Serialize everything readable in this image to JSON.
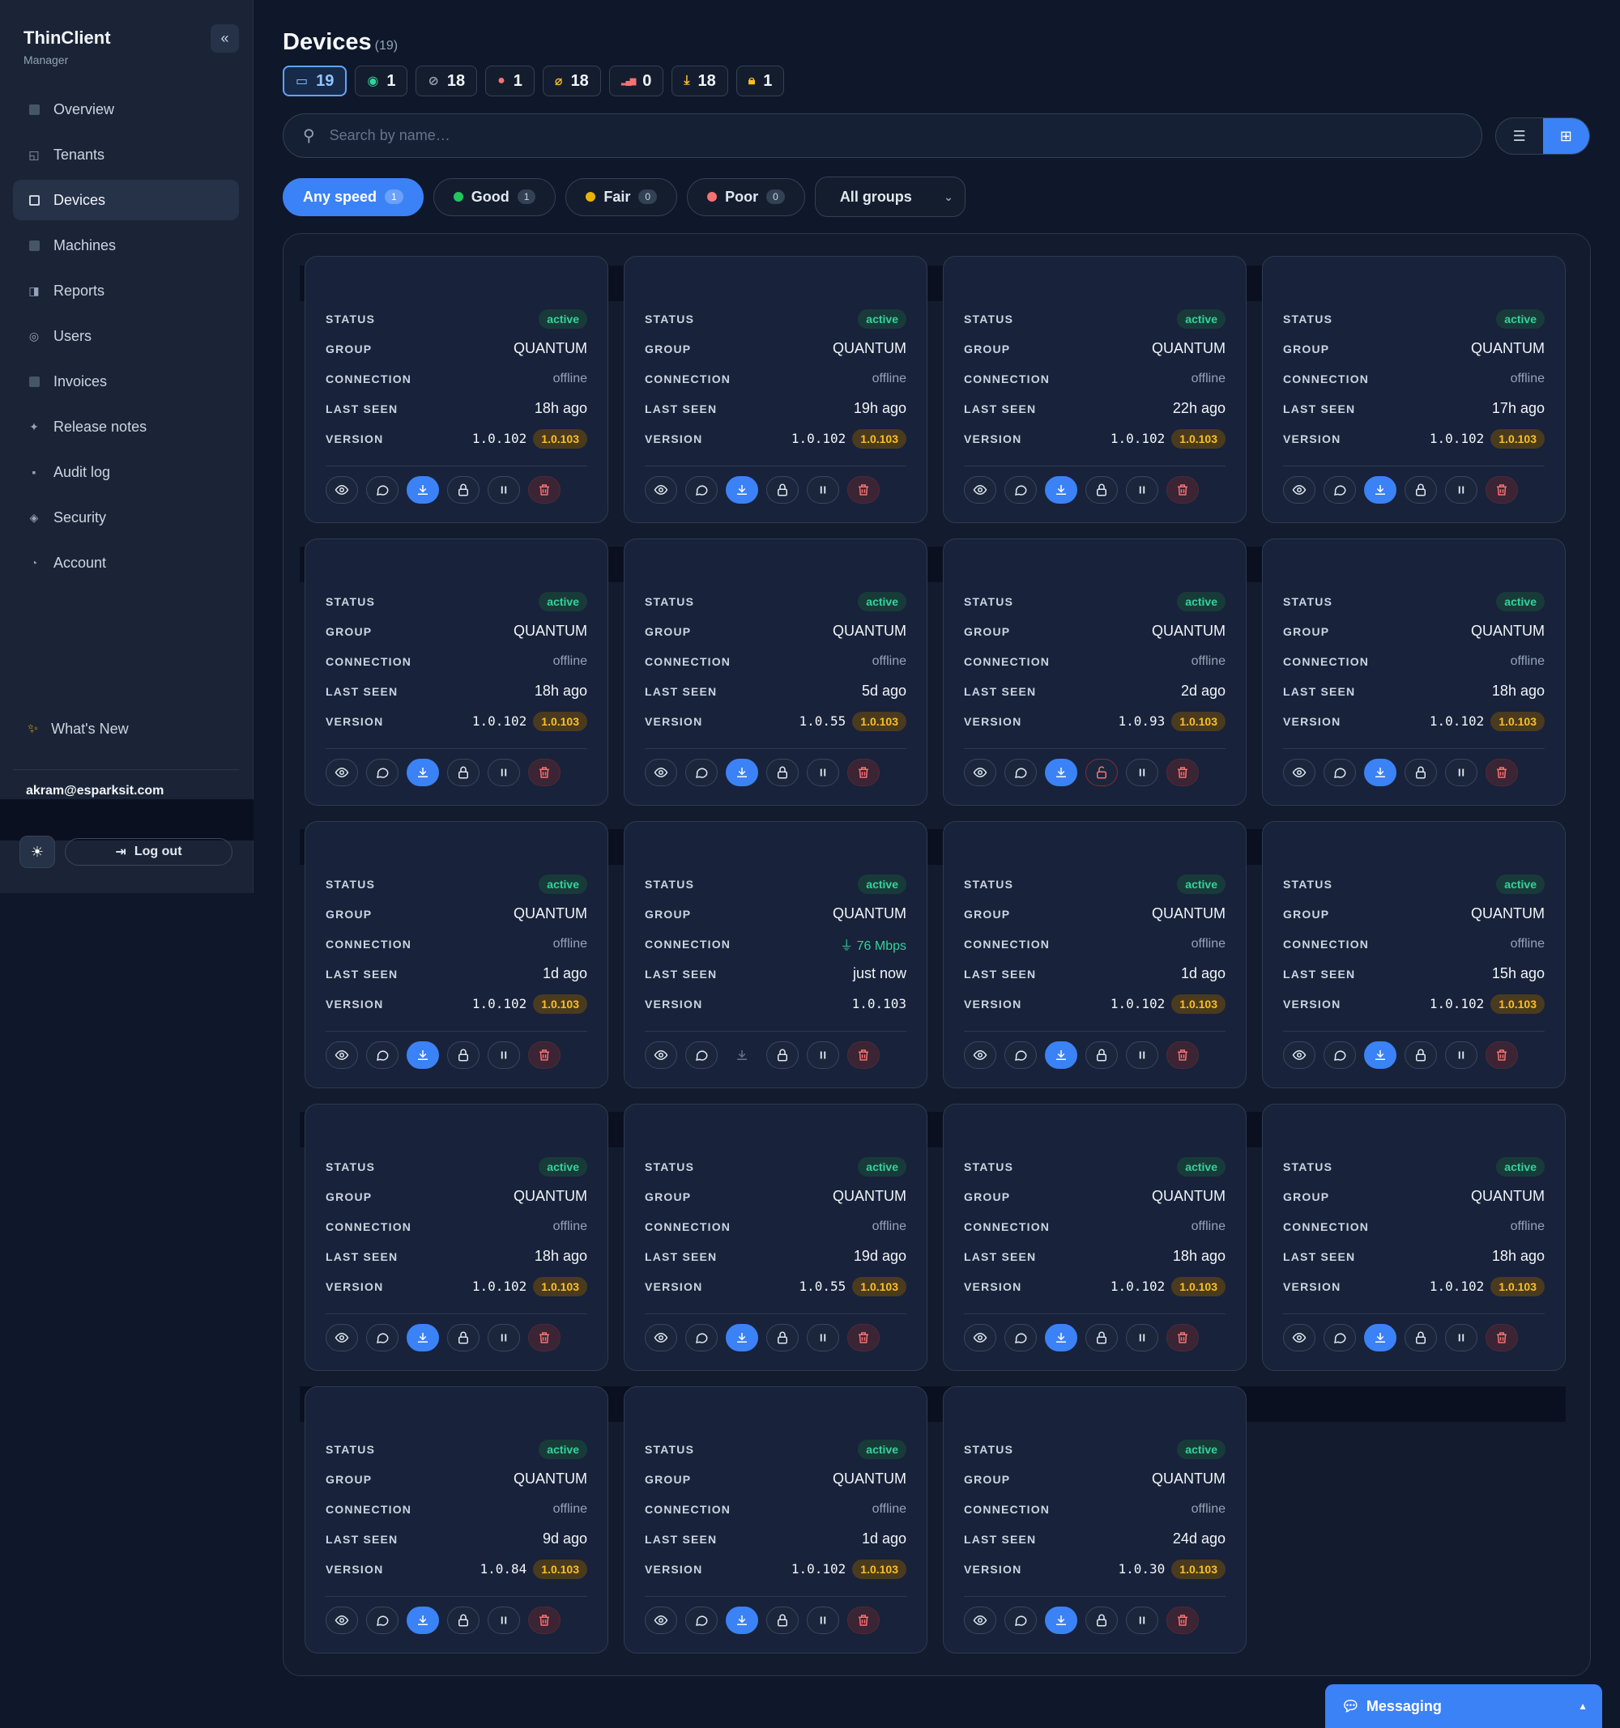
{
  "sidebar": {
    "brand_title": "ThinClient",
    "brand_sub": "Manager",
    "collapse_icon": "«",
    "items": [
      {
        "label": "Overview",
        "icon": "overview-icon",
        "glyph": "sq"
      },
      {
        "label": "Tenants",
        "icon": "tenants-icon",
        "glyph": "◱"
      },
      {
        "label": "Devices",
        "icon": "devices-icon",
        "glyph": "sq",
        "active": true
      },
      {
        "label": "Machines",
        "icon": "machines-icon",
        "glyph": "sq"
      },
      {
        "label": "Reports",
        "icon": "reports-icon",
        "glyph": "◨"
      },
      {
        "label": "Users",
        "icon": "users-icon",
        "glyph": "◎"
      },
      {
        "label": "Invoices",
        "icon": "invoices-icon",
        "glyph": "sq"
      },
      {
        "label": "Release notes",
        "icon": "release-notes-icon",
        "glyph": "✦"
      },
      {
        "label": "Audit log",
        "icon": "audit-log-icon",
        "glyph": "▪"
      },
      {
        "label": "Security",
        "icon": "security-icon",
        "glyph": "◈"
      },
      {
        "label": "Account",
        "icon": "account-icon",
        "glyph": "◔"
      }
    ],
    "whats_new": "What's New",
    "user_email": "akram@esparksit.com",
    "logout": "Log out"
  },
  "header": {
    "title": "Devices",
    "count": "(19)",
    "stats": [
      {
        "value": "19",
        "icon": "monitor-icon",
        "glyph": "▭",
        "color": "#93c5fd",
        "primary": true
      },
      {
        "value": "1",
        "icon": "online-icon",
        "glyph": "◉",
        "color": "#34d399"
      },
      {
        "value": "18",
        "icon": "offline-icon",
        "glyph": "⊘",
        "color": "#94a3b8"
      },
      {
        "value": "1",
        "icon": "alert-dot-icon",
        "glyph": "●",
        "color": "#f87171"
      },
      {
        "value": "18",
        "icon": "no-speed-icon",
        "glyph": "⌀",
        "color": "#fbbf24"
      },
      {
        "value": "0",
        "icon": "signal-icon",
        "glyph": "▂▄▆",
        "color": "#f87171"
      },
      {
        "value": "18",
        "icon": "download-icon",
        "glyph": "⤓",
        "color": "#fbbf24"
      },
      {
        "value": "1",
        "icon": "lock-icon",
        "glyph": "🔒︎",
        "color": "#fbbf24"
      }
    ]
  },
  "search": {
    "placeholder": "Search by name…"
  },
  "filters": [
    {
      "label": "Any speed",
      "count": "1",
      "active": true,
      "dot": ""
    },
    {
      "label": "Good",
      "count": "1",
      "dot": "#22c55e"
    },
    {
      "label": "Fair",
      "count": "0",
      "dot": "#eab308"
    },
    {
      "label": "Poor",
      "count": "0",
      "dot": "#f87171"
    }
  ],
  "group_select": {
    "value": "All groups"
  },
  "labels": {
    "status": "STATUS",
    "group": "GROUP",
    "connection": "CONNECTION",
    "last_seen": "LAST SEEN",
    "version": "VERSION"
  },
  "devices": [
    {
      "status": "active",
      "group": "QUANTUM",
      "connection": "offline",
      "last_seen": "18h ago",
      "version": "1.0.102",
      "latest": "1.0.103"
    },
    {
      "status": "active",
      "group": "QUANTUM",
      "connection": "offline",
      "last_seen": "19h ago",
      "version": "1.0.102",
      "latest": "1.0.103"
    },
    {
      "status": "active",
      "group": "QUANTUM",
      "connection": "offline",
      "last_seen": "22h ago",
      "version": "1.0.102",
      "latest": "1.0.103"
    },
    {
      "status": "active",
      "group": "QUANTUM",
      "connection": "offline",
      "last_seen": "17h ago",
      "version": "1.0.102",
      "latest": "1.0.103"
    },
    {
      "status": "active",
      "group": "QUANTUM",
      "connection": "offline",
      "last_seen": "18h ago",
      "version": "1.0.102",
      "latest": "1.0.103"
    },
    {
      "status": "active",
      "group": "QUANTUM",
      "connection": "offline",
      "last_seen": "5d ago",
      "version": "1.0.55",
      "latest": "1.0.103"
    },
    {
      "status": "active",
      "group": "QUANTUM",
      "connection": "offline",
      "last_seen": "2d ago",
      "version": "1.0.93",
      "latest": "1.0.103",
      "lock_open": true
    },
    {
      "status": "active",
      "group": "QUANTUM",
      "connection": "offline",
      "last_seen": "18h ago",
      "version": "1.0.102",
      "latest": "1.0.103"
    },
    {
      "status": "active",
      "group": "QUANTUM",
      "connection": "offline",
      "last_seen": "1d ago",
      "version": "1.0.102",
      "latest": "1.0.103"
    },
    {
      "status": "active",
      "group": "QUANTUM",
      "connection": "76 Mbps",
      "online": true,
      "last_seen": "just now",
      "version": "1.0.103",
      "latest": ""
    },
    {
      "status": "active",
      "group": "QUANTUM",
      "connection": "offline",
      "last_seen": "1d ago",
      "version": "1.0.102",
      "latest": "1.0.103"
    },
    {
      "status": "active",
      "group": "QUANTUM",
      "connection": "offline",
      "last_seen": "15h ago",
      "version": "1.0.102",
      "latest": "1.0.103"
    },
    {
      "status": "active",
      "group": "QUANTUM",
      "connection": "offline",
      "last_seen": "18h ago",
      "version": "1.0.102",
      "latest": "1.0.103"
    },
    {
      "status": "active",
      "group": "QUANTUM",
      "connection": "offline",
      "last_seen": "19d ago",
      "version": "1.0.55",
      "latest": "1.0.103"
    },
    {
      "status": "active",
      "group": "QUANTUM",
      "connection": "offline",
      "last_seen": "18h ago",
      "version": "1.0.102",
      "latest": "1.0.103"
    },
    {
      "status": "active",
      "group": "QUANTUM",
      "connection": "offline",
      "last_seen": "18h ago",
      "version": "1.0.102",
      "latest": "1.0.103"
    },
    {
      "status": "active",
      "group": "QUANTUM",
      "connection": "offline",
      "last_seen": "9d ago",
      "version": "1.0.84",
      "latest": "1.0.103"
    },
    {
      "status": "active",
      "group": "QUANTUM",
      "connection": "offline",
      "last_seen": "1d ago",
      "version": "1.0.102",
      "latest": "1.0.103"
    },
    {
      "status": "active",
      "group": "QUANTUM",
      "connection": "offline",
      "last_seen": "24d ago",
      "version": "1.0.30",
      "latest": "1.0.103"
    }
  ],
  "messaging": {
    "label": "Messaging",
    "icon": "chat-icon"
  }
}
